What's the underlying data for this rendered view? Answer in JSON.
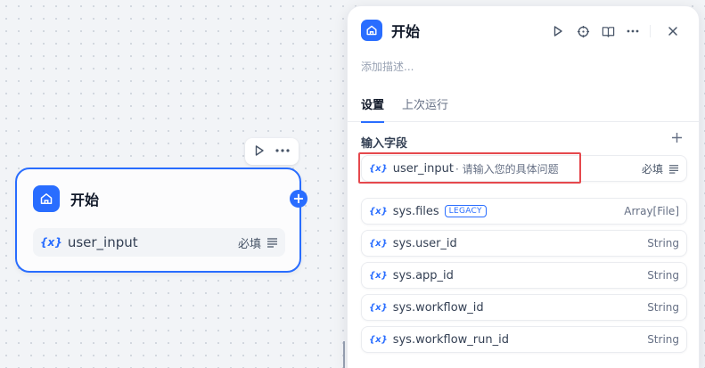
{
  "canvas": {
    "node": {
      "title": "开始",
      "variable": {
        "icon": "variable-icon",
        "icon_text": "{x}",
        "name": "user_input",
        "required": "必填"
      },
      "toolbar": {
        "run_icon": "play-icon",
        "more_icon": "more-icon"
      }
    }
  },
  "panel": {
    "title": "开始",
    "description_placeholder": "添加描述...",
    "actions": [
      "play-icon",
      "crosshair-icon",
      "book-icon",
      "more-icon",
      "close-icon"
    ],
    "tabs": [
      {
        "label": "设置"
      },
      {
        "label": "上次运行"
      }
    ],
    "section_title": "输入字段",
    "fields": [
      {
        "name": "user_input",
        "desc": "· 请输入您的具体问题",
        "tag": "必填",
        "type": ""
      },
      {
        "name": "sys.files",
        "badge": "LEGACY",
        "type": "Array[File]"
      },
      {
        "name": "sys.user_id",
        "type": "String"
      },
      {
        "name": "sys.app_id",
        "type": "String"
      },
      {
        "name": "sys.workflow_id",
        "type": "String"
      },
      {
        "name": "sys.workflow_run_id",
        "type": "String"
      }
    ],
    "var_icon_text": "{x}"
  },
  "colors": {
    "accent": "#296dff",
    "highlight": "#e5484d"
  }
}
